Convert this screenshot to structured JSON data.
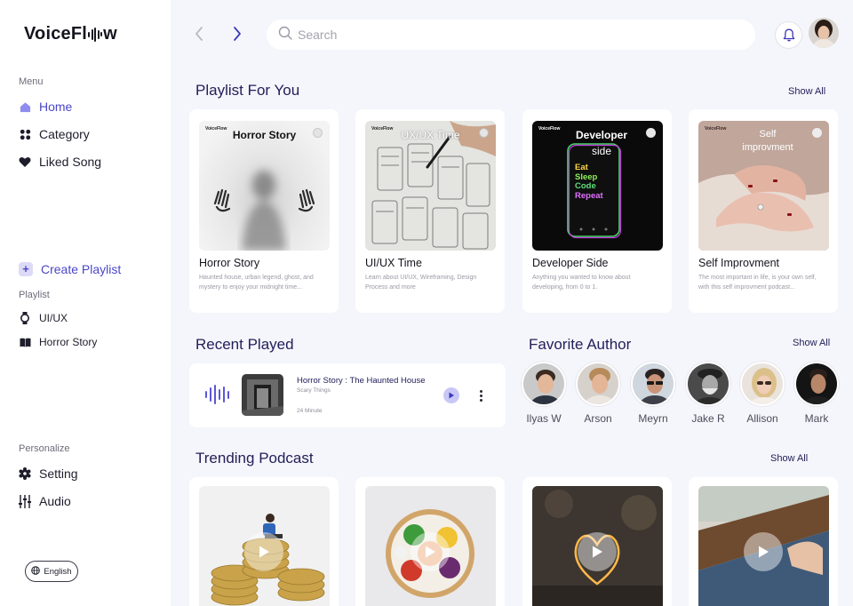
{
  "app": {
    "logo_before": "VoiceFl",
    "logo_after": "w"
  },
  "sidebar": {
    "menu_label": "Menu",
    "menu_items": [
      {
        "label": "Home",
        "icon": "home-icon",
        "active": true
      },
      {
        "label": "Category",
        "icon": "category-icon"
      },
      {
        "label": "Liked Song",
        "icon": "heart-icon"
      }
    ],
    "create_playlist": "Create Playlist",
    "playlist_label": "Playlist",
    "playlists": [
      {
        "label": "UI/UX",
        "icon": "watch-icon"
      },
      {
        "label": "Horror Story",
        "icon": "book-icon"
      }
    ],
    "personalize_label": "Personalize",
    "personalize_items": [
      {
        "label": "Setting",
        "icon": "gear-icon"
      },
      {
        "label": "Audio",
        "icon": "equalizer-icon"
      }
    ],
    "language": "English"
  },
  "search": {
    "placeholder": "Search"
  },
  "playlist_section": {
    "title": "Playlist For You",
    "show_all": "Show All",
    "cards": [
      {
        "thumb_title": "Horror Story",
        "mini_logo": "VoiceFlow",
        "title": "Horror Story",
        "desc": "Haunted house, urban legend, ghost, and mystery to enjoy your midnight time..."
      },
      {
        "thumb_title": "UX/UX Time",
        "mini_logo": "VoiceFlow",
        "title": "UI/UX Time",
        "desc": "Learn about UI/UX, Wireframing, Design Process and more"
      },
      {
        "thumb_title_line1": "Developer",
        "thumb_title_line2": "side",
        "mini_logo": "VoiceFlow",
        "phone_lines": [
          "Eat",
          "Sleep",
          "Code",
          "Repeat"
        ],
        "title": "Developer Side",
        "desc": "Anything you wanted to know about developing, from 0 to 1."
      },
      {
        "thumb_title_line1": "Self",
        "thumb_title_line2": "improvment",
        "mini_logo": "VoiceFlow",
        "title": "Self Improvment",
        "desc": "The most important in life, is your own self, with this self improvment podcast..."
      }
    ]
  },
  "recent_section": {
    "title": "Recent Played",
    "item": {
      "title": "Horror Story : The Haunted House",
      "subtitle": "Scary Things",
      "duration": "24 Minute"
    }
  },
  "author_section": {
    "title": "Favorite Author",
    "show_all": "Show All",
    "authors": [
      "Ilyas W",
      "Arson",
      "Meyrn",
      "Jake R",
      "Allison",
      "Mark"
    ]
  },
  "podcast_section": {
    "title": "Trending Podcast",
    "show_all": "Show All"
  },
  "colors": {
    "accent": "#4b46c8",
    "heading": "#22205a",
    "background": "#f5f6fb"
  }
}
